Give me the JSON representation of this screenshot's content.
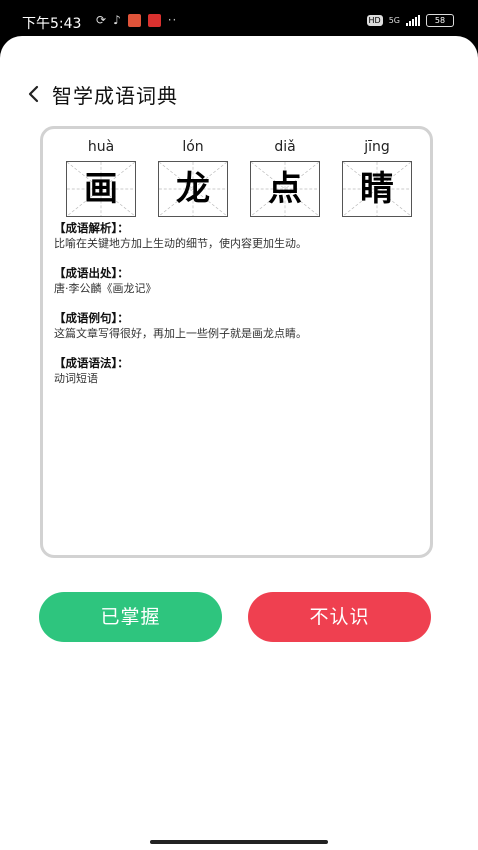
{
  "status_bar": {
    "time": "下午5:43",
    "battery": "58",
    "network": "5G"
  },
  "header": {
    "title": "智学成语词典"
  },
  "idiom": {
    "chars": [
      {
        "pinyin": "huà",
        "char": "画"
      },
      {
        "pinyin": "lón",
        "char": "龙"
      },
      {
        "pinyin": "diǎ",
        "char": "点"
      },
      {
        "pinyin": "jīng",
        "char": "睛"
      }
    ]
  },
  "sections": [
    {
      "title": "【成语解析】：",
      "body": "比喻在关键地方加上生动的细节，使内容更加生动。"
    },
    {
      "title": "【成语出处】：",
      "body": "唐·李公麟《画龙记》"
    },
    {
      "title": "【成语例句】：",
      "body": "这篇文章写得很好，再加上一些例子就是画龙点睛。"
    },
    {
      "title": "【成语语法】：",
      "body": "动词短语"
    }
  ],
  "buttons": {
    "known": "已掌握",
    "unknown": "不认识"
  },
  "colors": {
    "known": "#2ec57e",
    "unknown": "#ef4050"
  }
}
